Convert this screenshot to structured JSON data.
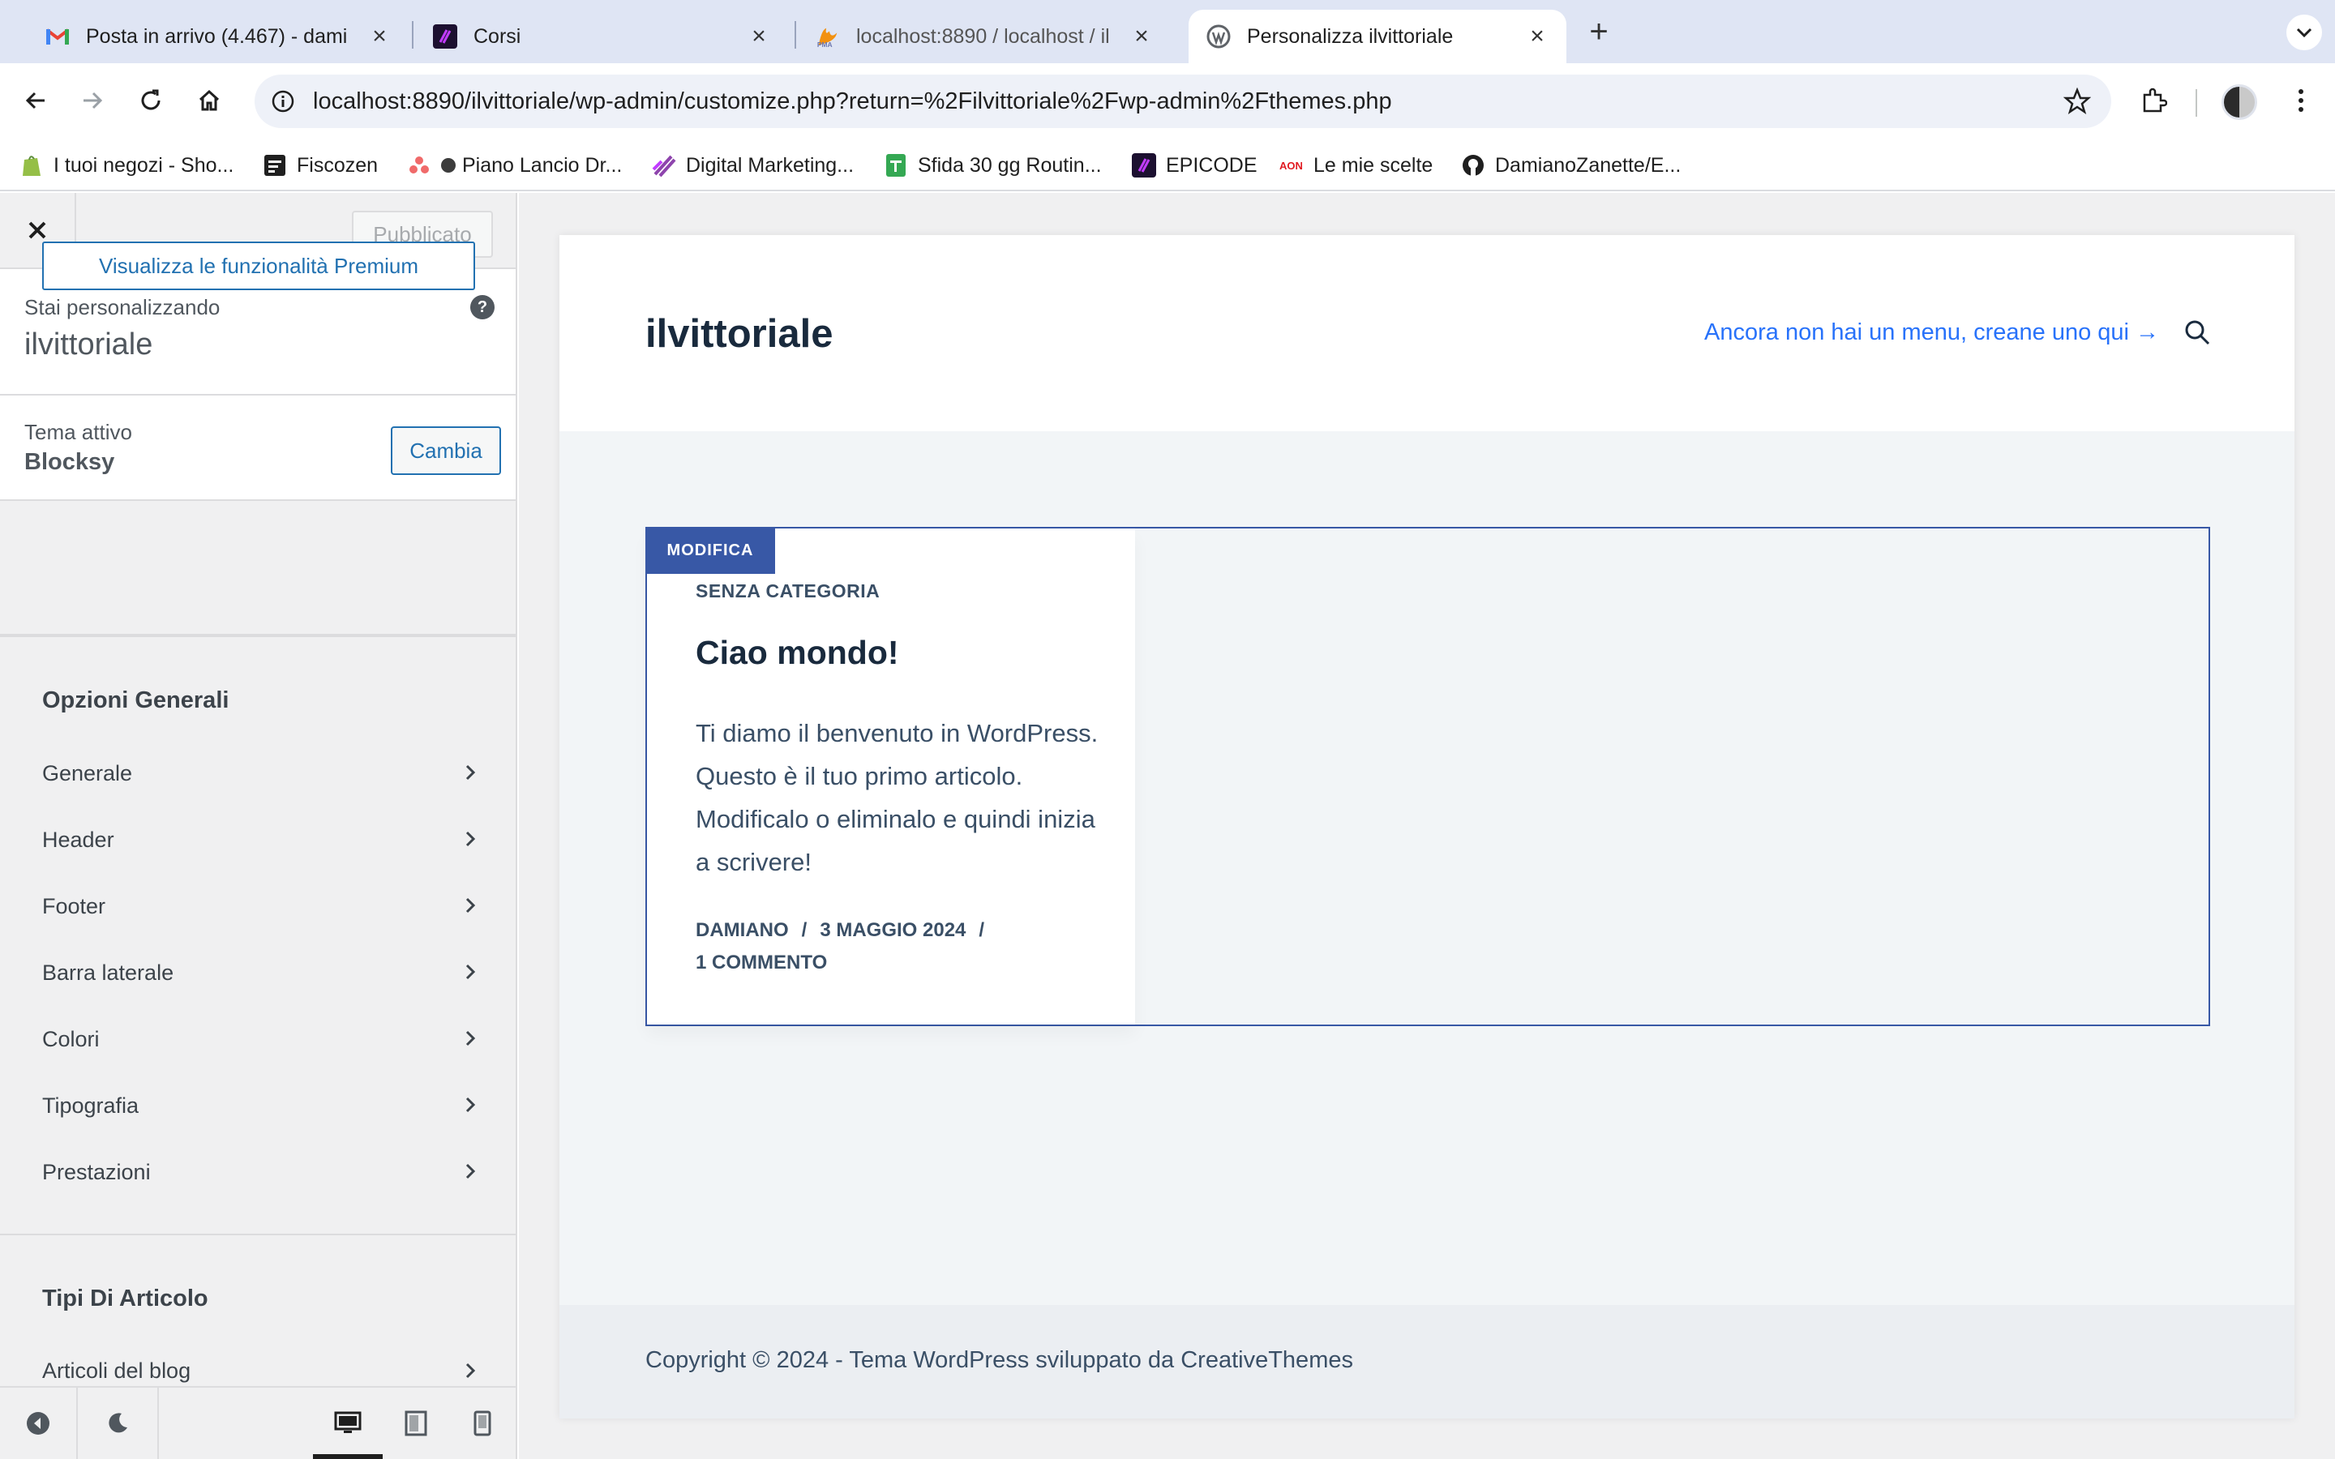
{
  "browser": {
    "tabs": [
      {
        "title": "Posta in arrivo (4.467) - dami",
        "favicon": "gmail-icon"
      },
      {
        "title": "Corsi",
        "favicon": "epicode-icon"
      },
      {
        "title": "localhost:8890 / localhost / il",
        "favicon": "phpmyadmin-icon"
      },
      {
        "title": "Personalizza ilvittoriale",
        "favicon": "wordpress-icon"
      }
    ],
    "url": "localhost:8890/ilvittoriale/wp-admin/customize.php?return=%2Filvittoriale%2Fwp-admin%2Fthemes.php",
    "bookmarks": [
      {
        "label": "I tuoi negozi - Sho...",
        "icon": "shopify-icon"
      },
      {
        "label": "Fiscozen",
        "icon": "fiscozen-icon"
      },
      {
        "label": "Piano Lancio Dr...",
        "icon": "asana-icon"
      },
      {
        "label": "Digital Marketing...",
        "icon": "bookmark-icon"
      },
      {
        "label": "Sfida 30 gg Routin...",
        "icon": "sheets-icon"
      },
      {
        "label": "EPICODE",
        "icon": "epicode-icon"
      },
      {
        "label": "Le mie scelte",
        "icon": "aon-icon"
      },
      {
        "label": "DamianoZanette/E...",
        "icon": "github-icon"
      }
    ]
  },
  "customizer": {
    "publish_label": "Pubblicato",
    "customizing_label": "Stai personalizzando",
    "site_name": "ilvittoriale",
    "active_theme_label": "Tema attivo",
    "theme_name": "Blocksy",
    "change_label": "Cambia",
    "premium_label": "Visualizza le funzionalità Premium",
    "general_section": "Opzioni Generali",
    "general_items": [
      "Generale",
      "Header",
      "Footer",
      "Barra laterale",
      "Colori",
      "Tipografia",
      "Prestazioni"
    ],
    "post_types_section": "Tipi Di Articolo",
    "post_types_items": [
      "Articoli del blog"
    ]
  },
  "preview": {
    "site_title": "ilvittoriale",
    "menu_prompt": "Ancora non hai un menu, creane uno qui →",
    "post": {
      "edit_badge": "MODIFICA",
      "category": "SENZA CATEGORIA",
      "title": "Ciao mondo!",
      "excerpt": "Ti diamo il benvenuto in WordPress. Questo è il tuo primo articolo. Modificalo o eliminalo e quindi inizia a scrivere!",
      "author": "DAMIANO",
      "date": "3 MAGGIO 2024",
      "comments": "1 COMMENTO"
    },
    "copyright": "Copyright © 2024 - Tema WordPress sviluppato da CreativeThemes"
  },
  "colors": {
    "wp_blue": "#2271b1",
    "link_blue": "#2872fa",
    "edit_badge_blue": "#3858a6",
    "heading_dark": "#192a3d"
  }
}
